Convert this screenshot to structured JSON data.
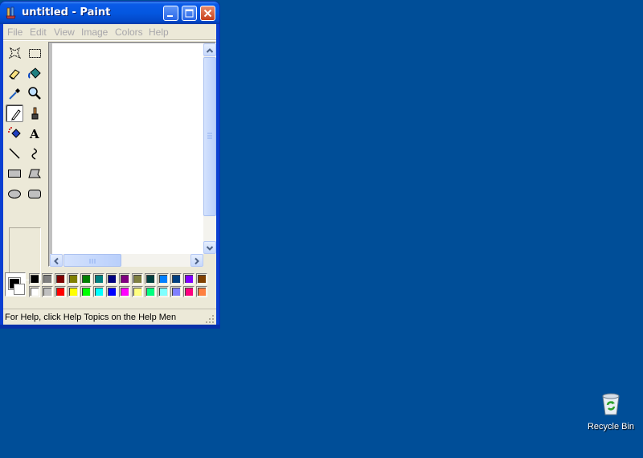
{
  "window": {
    "title": "untitled - Paint",
    "icon": "paint-app-icon",
    "controls": [
      "minimize",
      "maximize",
      "close"
    ]
  },
  "menu": [
    "File",
    "Edit",
    "View",
    "Image",
    "Colors",
    "Help"
  ],
  "tools": [
    {
      "name": "free-form-select",
      "icon": "free-form-select-icon"
    },
    {
      "name": "select",
      "icon": "rect-select-icon"
    },
    {
      "name": "eraser",
      "icon": "eraser-icon"
    },
    {
      "name": "fill-with-color",
      "icon": "paint-bucket-icon"
    },
    {
      "name": "pick-color",
      "icon": "eyedropper-icon"
    },
    {
      "name": "magnifier",
      "icon": "magnifier-icon"
    },
    {
      "name": "pencil",
      "icon": "pencil-icon",
      "active": true
    },
    {
      "name": "brush",
      "icon": "brush-icon"
    },
    {
      "name": "airbrush",
      "icon": "airbrush-icon"
    },
    {
      "name": "text",
      "icon": "text-icon"
    },
    {
      "name": "line",
      "icon": "line-icon"
    },
    {
      "name": "curve",
      "icon": "curve-icon"
    },
    {
      "name": "rectangle",
      "icon": "rectangle-icon"
    },
    {
      "name": "polygon",
      "icon": "polygon-icon"
    },
    {
      "name": "ellipse",
      "icon": "ellipse-icon"
    },
    {
      "name": "rounded-rectangle",
      "icon": "rounded-rectangle-icon"
    }
  ],
  "palette": {
    "foreground": "#000000",
    "background": "#ffffff",
    "row1": [
      "#000000",
      "#808080",
      "#800000",
      "#808000",
      "#008000",
      "#008080",
      "#000080",
      "#800080",
      "#808040",
      "#004040",
      "#0080ff",
      "#004080",
      "#8000ff",
      "#804000"
    ],
    "row2": [
      "#ffffff",
      "#c0c0c0",
      "#ff0000",
      "#ffff00",
      "#00ff00",
      "#00ffff",
      "#0000ff",
      "#ff00ff",
      "#ffff80",
      "#00ff80",
      "#80ffff",
      "#8080ff",
      "#ff0080",
      "#ff8040"
    ]
  },
  "status": "For Help, click Help Topics on the Help Men",
  "desktop": {
    "background": "#004e98",
    "icons": [
      {
        "label": "Recycle Bin",
        "icon": "recycle-bin-icon"
      }
    ]
  }
}
